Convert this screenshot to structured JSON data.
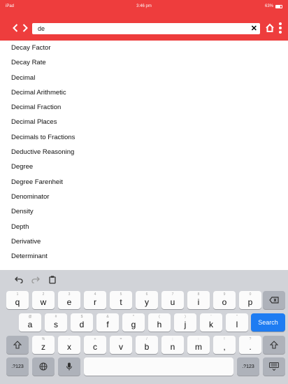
{
  "status": {
    "carrier": "iPad",
    "time": "3:46 pm",
    "battery": "63%"
  },
  "search": {
    "value": "de"
  },
  "results": [
    "Decay Factor",
    "Decay Rate",
    "Decimal",
    "Decimal Arithmetic",
    "Decimal Fraction",
    "Decimal Places",
    "Decimals to Fractions",
    "Deductive Reasoning",
    "Degree",
    "Degree Farenheit",
    "Denominator",
    "Density",
    "Depth",
    "Derivative",
    "Determinant"
  ],
  "keyboard": {
    "row1": [
      [
        "1",
        "q"
      ],
      [
        "2",
        "w"
      ],
      [
        "3",
        "e"
      ],
      [
        "4",
        "r"
      ],
      [
        "5",
        "t"
      ],
      [
        "6",
        "y"
      ],
      [
        "7",
        "u"
      ],
      [
        "8",
        "i"
      ],
      [
        "9",
        "o"
      ],
      [
        "0",
        "p"
      ]
    ],
    "row2": [
      [
        "@",
        "a"
      ],
      [
        "#",
        "s"
      ],
      [
        "$",
        "d"
      ],
      [
        "&",
        "f"
      ],
      [
        "*",
        "g"
      ],
      [
        "(",
        "h"
      ],
      [
        ")",
        "j"
      ],
      [
        "'",
        "k"
      ],
      [
        "\"",
        "l"
      ]
    ],
    "row3": [
      [
        "%",
        "z"
      ],
      [
        "-",
        "x"
      ],
      [
        "+",
        "c"
      ],
      [
        "=",
        "v"
      ],
      [
        "/",
        "b"
      ],
      [
        ";",
        "n"
      ],
      [
        ":",
        "m"
      ],
      [
        "!",
        ","
      ],
      [
        "?",
        "."
      ]
    ],
    "search_label": "Search",
    "numbers_label": ".?123"
  }
}
